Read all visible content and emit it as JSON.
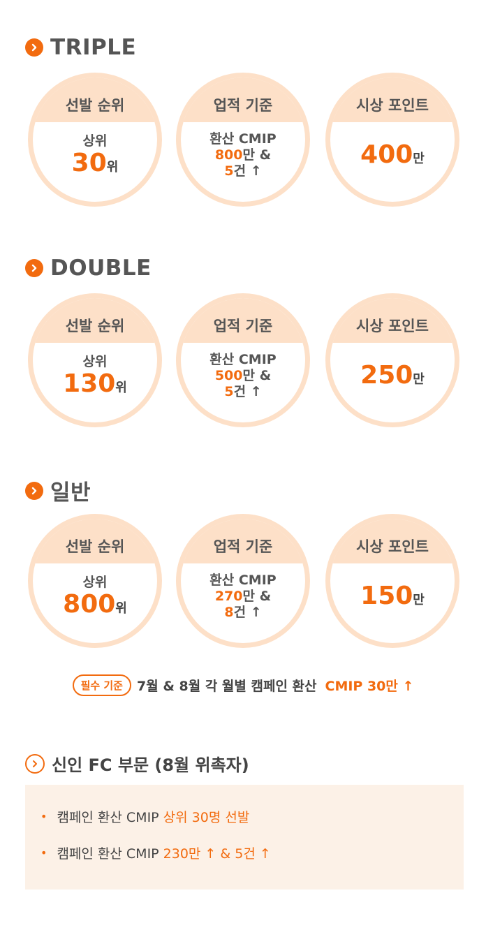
{
  "tiers": [
    {
      "title": "TRIPLE",
      "rank": {
        "header": "선발 순위",
        "prefix": "상위",
        "value": "30",
        "unit": "위"
      },
      "criteria": {
        "header": "업적 기준",
        "line1": "환산 CMIP",
        "amount": "800",
        "amount_unit": "만 &",
        "count": "5",
        "count_unit": "건 ↑"
      },
      "points": {
        "header": "시상 포인트",
        "value": "400",
        "unit": "만"
      }
    },
    {
      "title": "DOUBLE",
      "rank": {
        "header": "선발 순위",
        "prefix": "상위",
        "value": "130",
        "unit": "위"
      },
      "criteria": {
        "header": "업적 기준",
        "line1": "환산 CMIP",
        "amount": "500",
        "amount_unit": "만 &",
        "count": "5",
        "count_unit": "건 ↑"
      },
      "points": {
        "header": "시상 포인트",
        "value": "250",
        "unit": "만"
      }
    },
    {
      "title": "일반",
      "rank": {
        "header": "선발 순위",
        "prefix": "상위",
        "value": "800",
        "unit": "위"
      },
      "criteria": {
        "header": "업적 기준",
        "line1": "환산 CMIP",
        "amount": "270",
        "amount_unit": "만 &",
        "count": "8",
        "count_unit": "건 ↑"
      },
      "points": {
        "header": "시상 포인트",
        "value": "150",
        "unit": "만"
      }
    }
  ],
  "requirement": {
    "badge": "필수 기준",
    "text": "7월 & 8월 각 월별 캠페인 환산",
    "highlight": "CMIP 30만 ↑"
  },
  "new_fc": {
    "title": "신인 FC 부문 (8월 위촉자)",
    "items": [
      {
        "text": "캠페인 환산 CMIP",
        "highlight": "상위 30명 선발"
      },
      {
        "text": "캠페인 환산 CMIP",
        "highlight": "230만 ↑ & 5건 ↑"
      }
    ]
  },
  "icons": {
    "section_arrow": "chevron-right-icon",
    "accent": "#f26b0f",
    "circle_ring": "#fde0c8",
    "box_bg": "#fcf1e7"
  }
}
